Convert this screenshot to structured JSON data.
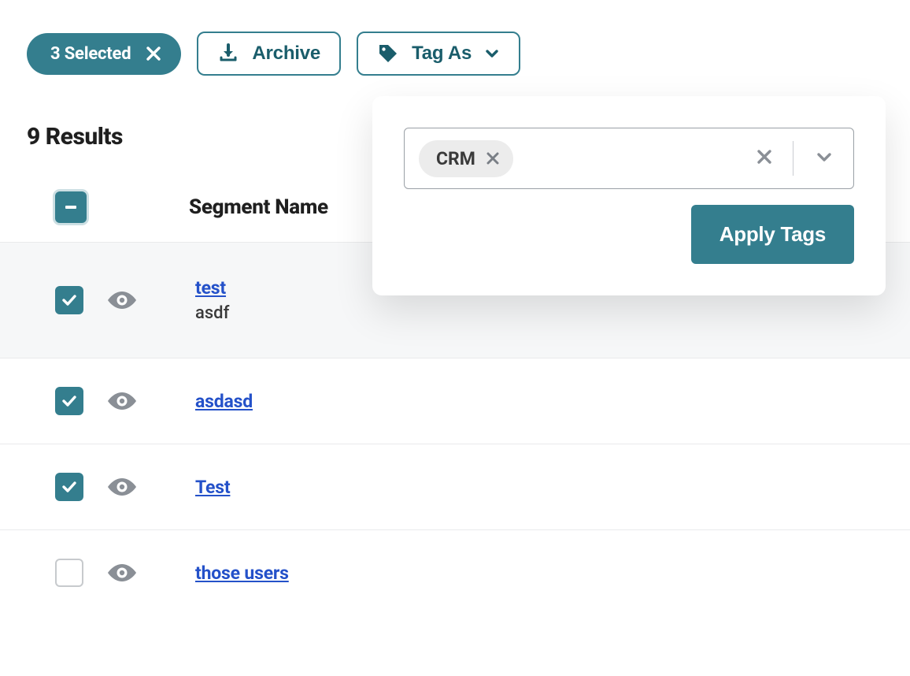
{
  "toolbar": {
    "selected_label": "3 Selected",
    "archive_label": "Archive",
    "tagas_label": "Tag As"
  },
  "results": {
    "count_label": "9 Results"
  },
  "popover": {
    "tag_chip": "CRM",
    "apply_label": "Apply Tags"
  },
  "table": {
    "header": {
      "segment_name": "Segment Name"
    },
    "rows": [
      {
        "checked": true,
        "name": "test",
        "sub": "asdf"
      },
      {
        "checked": true,
        "name": "asdasd",
        "sub": ""
      },
      {
        "checked": true,
        "name": "Test",
        "sub": ""
      },
      {
        "checked": false,
        "name": "those users",
        "sub": ""
      }
    ]
  }
}
